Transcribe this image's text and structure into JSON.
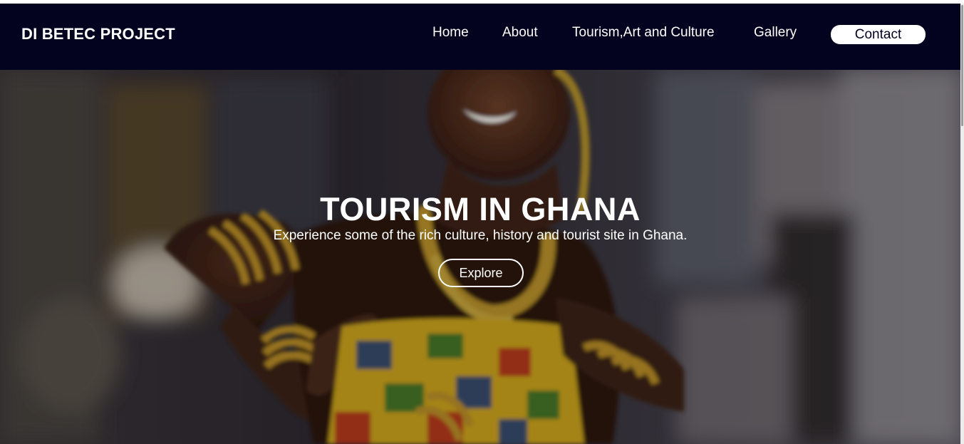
{
  "header": {
    "brand": "DI BETEC PROJECT",
    "nav": [
      {
        "label": "Home"
      },
      {
        "label": "About"
      },
      {
        "label": "Tourism,Art and Culture"
      },
      {
        "label": "Gallery"
      }
    ],
    "contact_label": "Contact"
  },
  "hero": {
    "title": "TOURISM IN GHANA",
    "subtitle": "Experience some of the rich culture, history and tourist site in Ghana.",
    "button_label": "Explore"
  },
  "colors": {
    "navbar": "#03021f",
    "text": "#ffffff",
    "contact_bg": "#ffffff",
    "contact_text": "#03021f"
  }
}
